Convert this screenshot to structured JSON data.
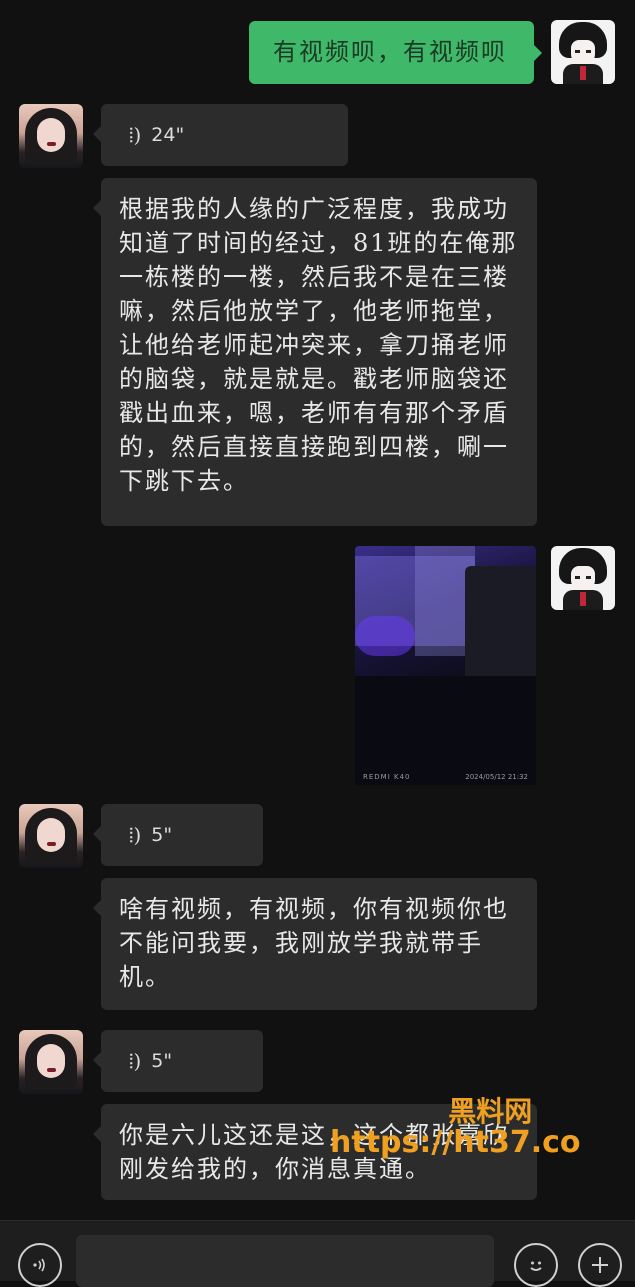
{
  "messages": {
    "m1": {
      "text": "有视频呗，有视频呗"
    },
    "m2": {
      "duration": "24\""
    },
    "m3": {
      "text": "根据我的人缘的广泛程度，我成功\n知道了时间的经过，81班的在俺那\n一栋楼的一楼，然后我不是在三楼\n嘛，然后他放学了，他老师拖堂，\n让他给老师起冲突来，拿刀捅老师\n的脑袋，就是就是。戳老师脑袋还\n戳出血来，嗯，老师有有那个矛盾\n的，然后直接直接跑到四楼，唰一\n下跳下去。"
    },
    "m4": {
      "photo_caption_left": "REDMI K40",
      "photo_caption_right": "2024/05/12  21:32"
    },
    "m5": {
      "duration": "5\""
    },
    "m6": {
      "text": "啥有视频，有视频，你有视频你也\n不能问我要，我刚放学我就带手\n机。"
    },
    "m7": {
      "duration": "5\""
    },
    "m8": {
      "text": "你是六儿这还是这，这个都张嘉欣\n刚发给我的，你消息真通。"
    }
  },
  "watermark": {
    "line1": "黑料网",
    "line2": "https://ht37.co"
  },
  "icons": {
    "voice_wave": "⦙)",
    "voice_button": "voice-icon",
    "emoji_button": "emoji-icon",
    "plus_button": "plus-icon"
  },
  "colors": {
    "background": "#111111",
    "bubble": "#2c2c2c",
    "sent_bubble": "#3fb86a",
    "watermark": "#f0a020"
  }
}
